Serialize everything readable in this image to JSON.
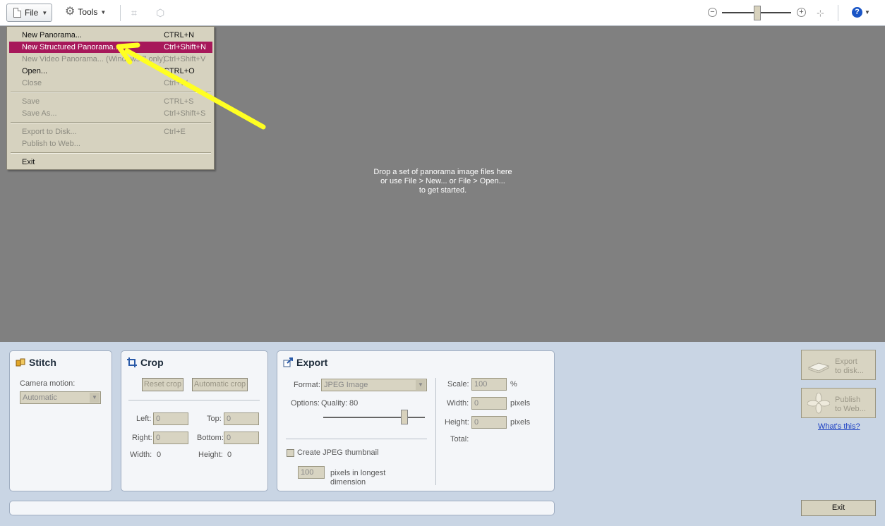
{
  "toolbar": {
    "file_label": "File",
    "tools_label": "Tools"
  },
  "canvas": {
    "drop_line1": "Drop a set of panorama image files here",
    "drop_line2": "or use File > New... or File > Open...",
    "drop_line3": "to get started."
  },
  "file_menu": {
    "items": [
      {
        "label": "New Panorama...",
        "shortcut": "CTRL+N",
        "state": "enabled"
      },
      {
        "label": "New Structured Panorama...",
        "shortcut": "Ctrl+Shift+N",
        "state": "selected"
      },
      {
        "label": "New Video Panorama... (Windows 7 only)",
        "shortcut": "Ctrl+Shift+V",
        "state": "disabled"
      },
      {
        "label": "Open...",
        "shortcut": "CTRL+O",
        "state": "enabled"
      },
      {
        "label": "Close",
        "shortcut": "Ctrl+W",
        "state": "disabled"
      },
      {
        "label": "Save",
        "shortcut": "CTRL+S",
        "state": "disabled"
      },
      {
        "label": "Save As...",
        "shortcut": "Ctrl+Shift+S",
        "state": "disabled"
      },
      {
        "label": "Export to Disk...",
        "shortcut": "Ctrl+E",
        "state": "disabled"
      },
      {
        "label": "Publish to Web...",
        "shortcut": "",
        "state": "disabled"
      },
      {
        "label": "Exit",
        "shortcut": "",
        "state": "enabled"
      }
    ]
  },
  "stitch": {
    "title": "Stitch",
    "camera_motion_label": "Camera motion:",
    "camera_motion_value": "Automatic"
  },
  "crop": {
    "title": "Crop",
    "reset_label": "Reset crop",
    "auto_label": "Automatic crop",
    "left_label": "Left:",
    "left_value": "0",
    "top_label": "Top:",
    "top_value": "0",
    "right_label": "Right:",
    "right_value": "0",
    "bottom_label": "Bottom:",
    "bottom_value": "0",
    "width_label": "Width:",
    "width_value": "0",
    "height_label": "Height:",
    "height_value": "0"
  },
  "export": {
    "title": "Export",
    "format_label": "Format:",
    "format_value": "JPEG Image",
    "options_label": "Options:",
    "quality_label": "Quality:",
    "quality_value": "80",
    "quality_fraction": 0.8,
    "thumbnail_label": "Create JPEG thumbnail",
    "thumb_size_value": "100",
    "thumb_size_label_1": "pixels in longest",
    "thumb_size_label_2": "dimension",
    "scale_label": "Scale:",
    "scale_value": "100",
    "scale_unit": "%",
    "width_label": "Width:",
    "width_value": "0",
    "width_unit": "pixels",
    "height_label": "Height:",
    "height_value": "0",
    "height_unit": "pixels",
    "total_label": "Total:"
  },
  "side": {
    "export_line1": "Export",
    "export_line2": "to disk...",
    "publish_line1": "Publish",
    "publish_line2": "to Web...",
    "whats_this": "What's this?",
    "exit_label": "Exit"
  },
  "colors": {
    "menu_highlight": "#a7185a",
    "annotation_arrow": "#ffff22",
    "canvas_bg": "#808080"
  },
  "icons": [
    "document-icon",
    "gear-icon",
    "crop-icon",
    "3d-box-icon",
    "zoom-out-icon",
    "zoom-in-icon",
    "fit-icon",
    "help-icon",
    "stitch-icon",
    "export-icon"
  ]
}
